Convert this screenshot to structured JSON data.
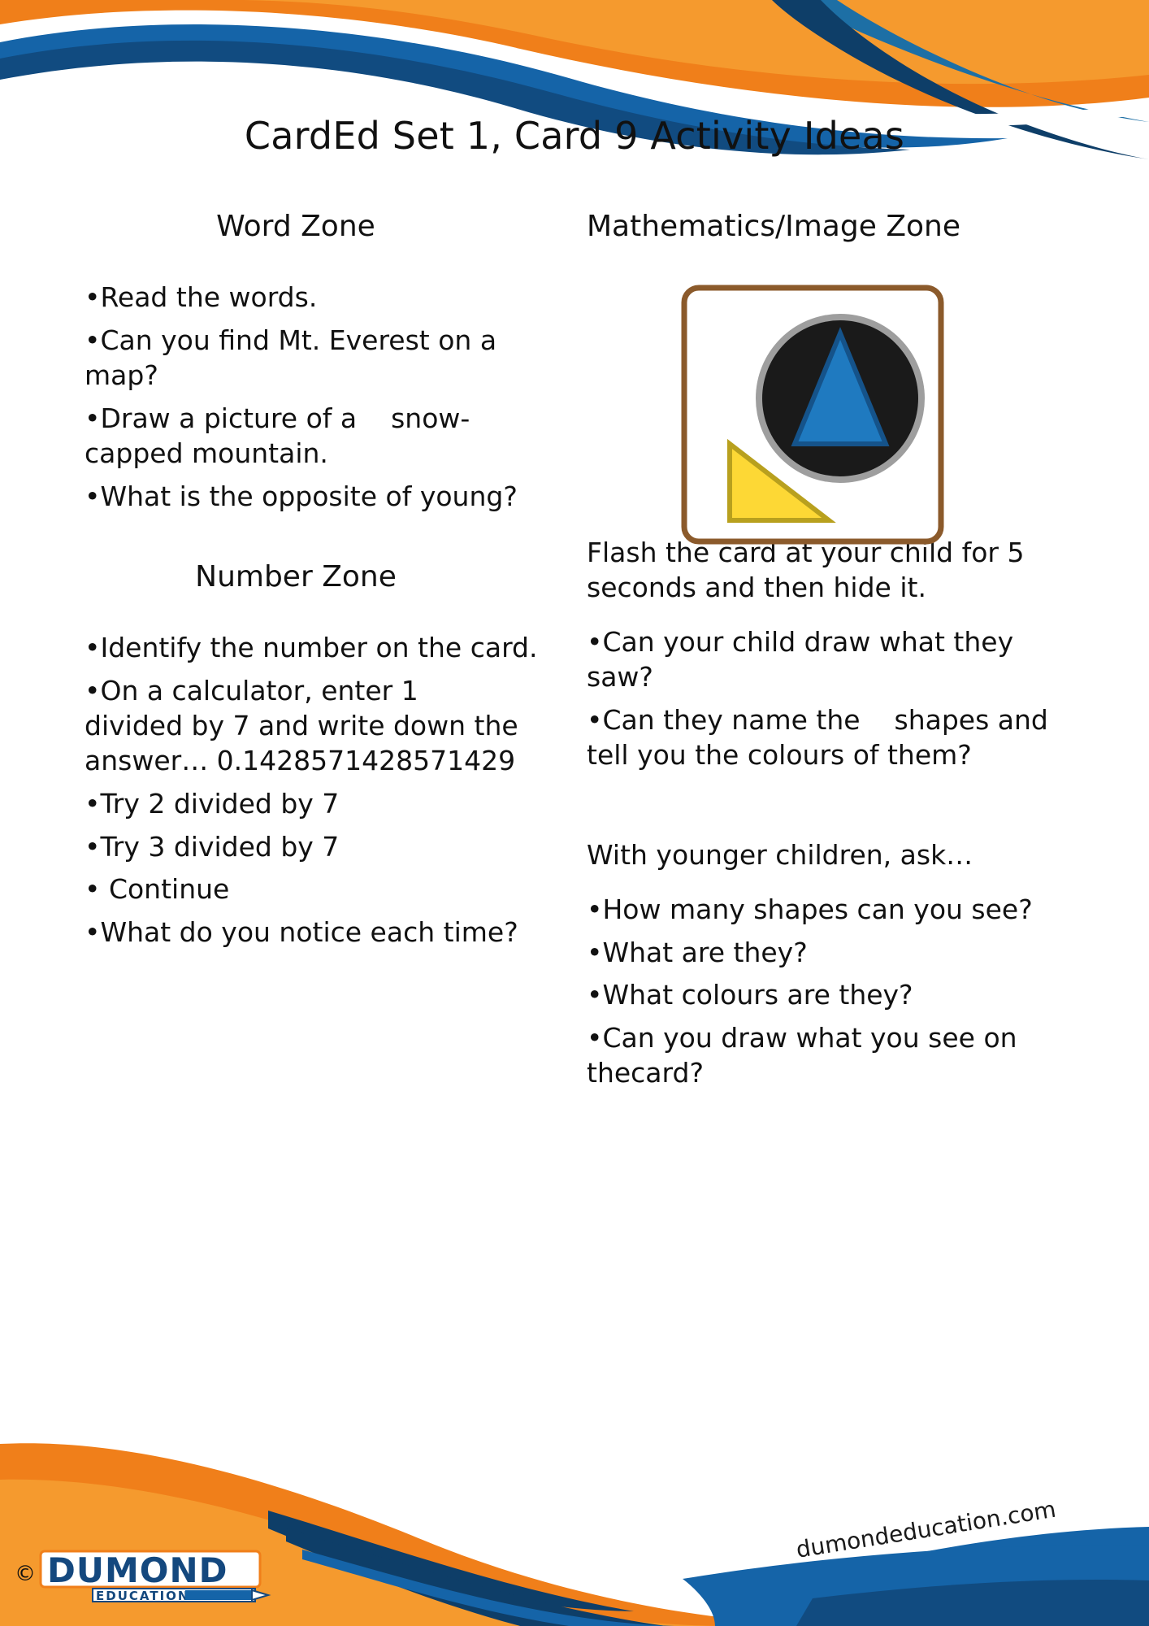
{
  "title": "CardEd Set 1, Card 9 Activity Ideas",
  "colors": {
    "orange": "#F07F1A",
    "orange_light": "#F59A2E",
    "blue": "#1564A8",
    "blue_dark": "#114B80",
    "navy": "#0E3E68",
    "card_border": "#8B5A2B",
    "circle_fill": "#1A1A1A",
    "circle_ring": "#9E9E9E",
    "triangle_blue": "#1F7AC0",
    "triangle_blue_stroke": "#15538A",
    "triangle_yellow": "#FDD835",
    "triangle_yellow_stroke": "#B8A01E",
    "text": "#111111"
  },
  "left_column": {
    "word_zone": {
      "heading": "Word Zone",
      "bullets": [
        "•Read the words.",
        "•Can you find Mt. Everest on a map?",
        "•Draw a picture of a    snow-capped mountain.",
        "•What is the opposite of young?"
      ]
    },
    "number_zone": {
      "heading": "Number Zone",
      "bullets": [
        "•Identify the number on the card.",
        "•On a calculator, enter 1    divided by 7 and write down the answer… 0.1428571428571429",
        "•Try 2 divided by 7",
        "•Try 3 divided by 7",
        "• Continue",
        "•What do you notice each time?"
      ]
    }
  },
  "right_column": {
    "math_zone": {
      "heading": "Mathematics/Image Zone",
      "card": {
        "shapes": [
          {
            "name": "circle",
            "colour": "black"
          },
          {
            "name": "triangle",
            "colour": "blue"
          },
          {
            "name": "right-triangle",
            "colour": "yellow"
          }
        ]
      },
      "intro": "Flash the card at your child for 5 seconds and then hide it.",
      "bullets": [
        "•Can your child draw what they saw?",
        "•Can they name the    shapes and tell you the colours of them?"
      ],
      "younger_intro": "With younger children, ask…",
      "younger_bullets": [
        "•How many shapes can you see?",
        "•What are they?",
        "•What colours are they?",
        "•Can you draw what you see on thecard?"
      ]
    }
  },
  "footer": {
    "url": "dumondeducation.com",
    "logo_name": "DUMOND",
    "logo_sub": "EDUCATION",
    "copyright": "©"
  }
}
